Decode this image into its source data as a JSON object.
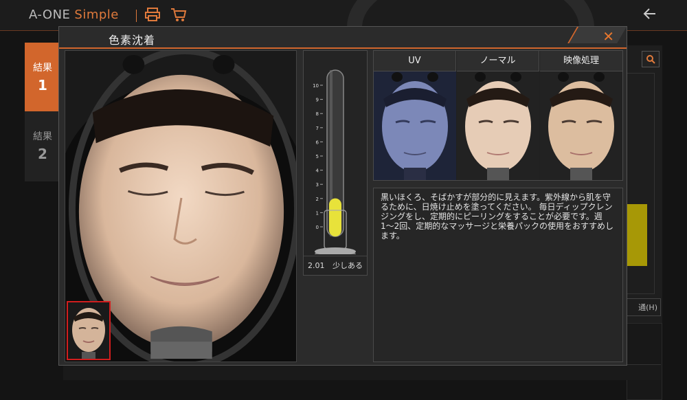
{
  "app": {
    "brand_main": "A-ONE",
    "brand_sub": "Simple",
    "icons": [
      "printer-icon",
      "cart-icon",
      "back-arrow-icon"
    ]
  },
  "sidebar": {
    "tabs": [
      {
        "label": "結果",
        "num": "1",
        "active": true
      },
      {
        "label": "結果",
        "num": "2",
        "active": false
      }
    ]
  },
  "background_right": {
    "label": "通(H)"
  },
  "modal": {
    "title": "色素沈着",
    "close_icon": "close-icon"
  },
  "gauge": {
    "ticks": [
      "10",
      "9",
      "8",
      "7",
      "6",
      "5",
      "4",
      "3",
      "2",
      "1",
      "0"
    ],
    "max": 10,
    "value": 2.01,
    "value_label": "2.01",
    "level_label": "少しある",
    "fill_color": "#e8e23a"
  },
  "views": {
    "headers": [
      "UV",
      "ノーマル",
      "映像処理"
    ]
  },
  "description": {
    "text": "黒いほくろ、そばかすが部分的に見えます。紫外線から肌を守るために、日焼け止めを塗ってください。 毎日ディップクレンジングをし、定期的にピーリングをすることが必要です。週1〜2回、定期的なマッサージと栄養パックの使用をおすすめします。"
  },
  "colors": {
    "accent": "#d2662c",
    "thumb_border": "#d21e1e"
  }
}
